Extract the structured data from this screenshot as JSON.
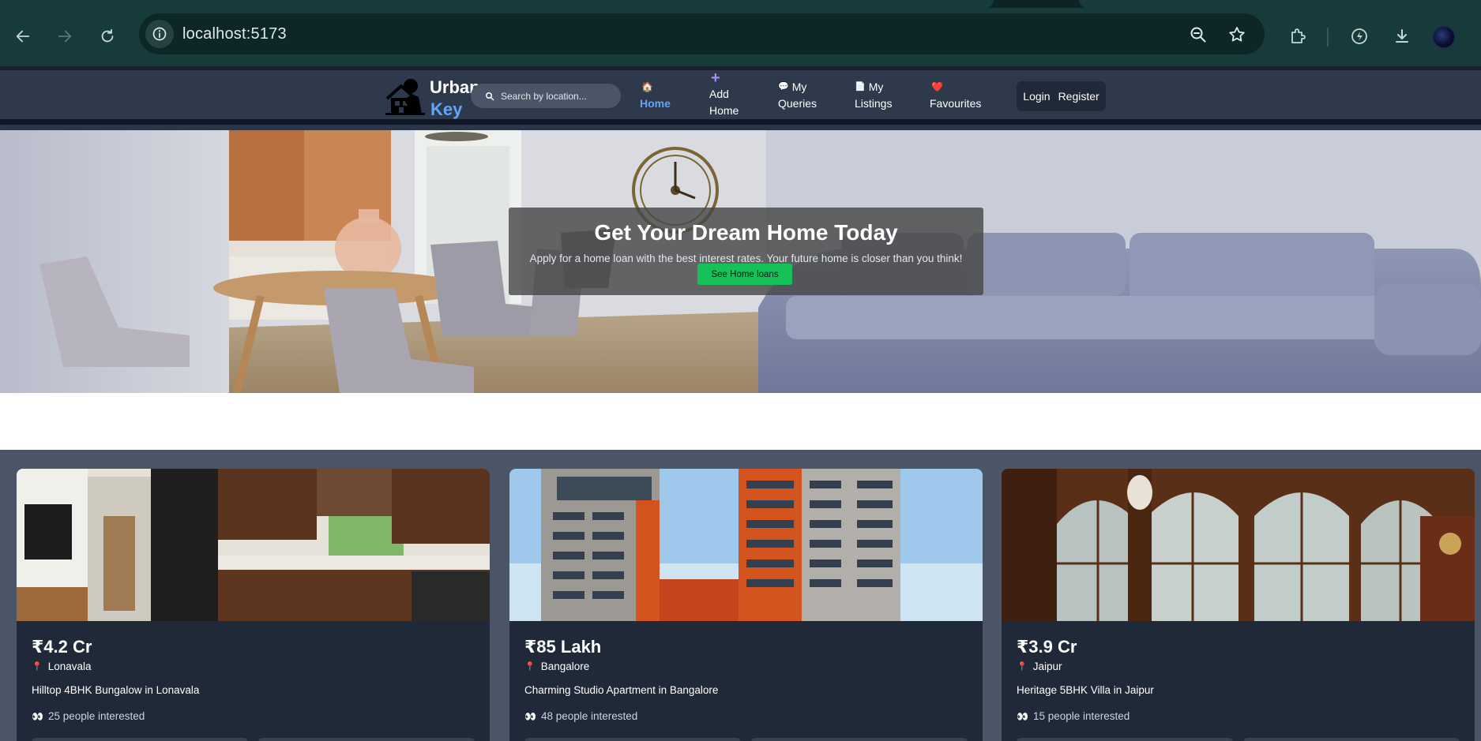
{
  "browser": {
    "url": "localhost:5173",
    "back_icon": "back-arrow-icon",
    "forward_icon": "forward-arrow-icon",
    "reload_icon": "reload-icon",
    "info_icon": "info-icon",
    "zoom_icon": "zoom-out-icon",
    "bookmark_icon": "star-icon",
    "extensions_icon": "puzzle-icon",
    "performance_icon": "performance-icon",
    "download_icon": "download-icon",
    "profile_icon": "avatar"
  },
  "navbar": {
    "brand_line1": "Urban",
    "brand_line2": "Key",
    "search_placeholder": "Search by location...",
    "items": [
      {
        "icon": "🏠",
        "label": "Home",
        "active": true
      },
      {
        "icon": "+",
        "label1": "Add",
        "label2": "Home"
      },
      {
        "icon": "💬",
        "label1": "My",
        "label2": "Queries"
      },
      {
        "icon": "📄",
        "label1": "My",
        "label2": "Listings"
      },
      {
        "icon": "❤️",
        "label": "Favourites"
      }
    ],
    "login": "Login",
    "register": "Register",
    "accent": "#60a5fa"
  },
  "hero": {
    "title": "Get Your Dream Home Today",
    "subtitle": "Apply for a home loan with the best interest rates. Your future home is closer than you think!",
    "button": "See Home loans",
    "button_color": "#16c15a"
  },
  "listings": [
    {
      "price": "₹4.2 Cr",
      "location": "Lonavala",
      "title": "Hilltop 4BHK Bungalow in Lonavala",
      "interested": "25 people interested"
    },
    {
      "price": "₹85 Lakh",
      "location": "Bangalore",
      "title": "Charming Studio Apartment in Bangalore",
      "interested": "48 people interested"
    },
    {
      "price": "₹3.9 Cr",
      "location": "Jaipur",
      "title": "Heritage 5BHK Villa in Jaipur",
      "interested": "15 people interested"
    }
  ]
}
